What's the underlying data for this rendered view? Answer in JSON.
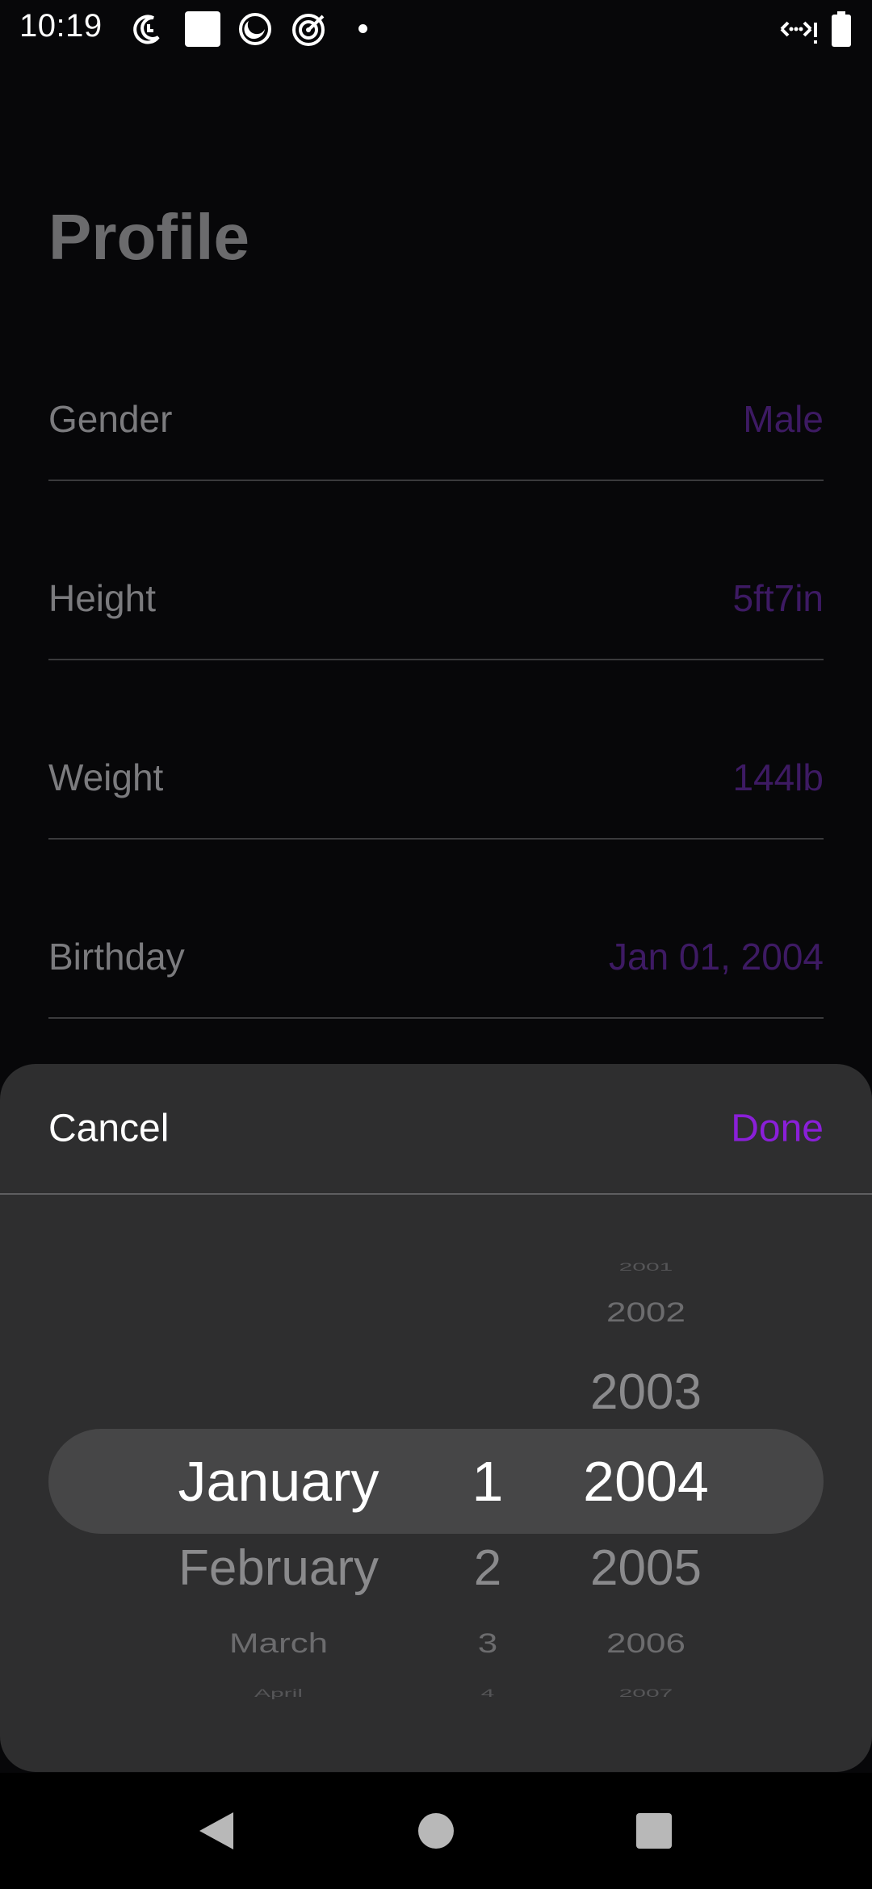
{
  "status_bar": {
    "time": "10:19",
    "icons": [
      "do-not-disturb-moon-icon",
      "white-square-icon",
      "circle-face-icon",
      "target-icon",
      "notification-dot-icon",
      "data-arrows-icon",
      "battery-icon"
    ]
  },
  "profile": {
    "title": "Profile",
    "rows": [
      {
        "label": "Gender",
        "value": "Male"
      },
      {
        "label": "Height",
        "value": "5ft7in"
      },
      {
        "label": "Weight",
        "value": "144lb"
      },
      {
        "label": "Birthday",
        "value": "Jan 01, 2004"
      }
    ]
  },
  "sheet": {
    "cancel_label": "Cancel",
    "done_label": "Done",
    "picker": {
      "months": [
        "January",
        "February",
        "March",
        "April"
      ],
      "days": [
        "1",
        "2",
        "3",
        "4"
      ],
      "years": [
        "2001",
        "2002",
        "2003",
        "2004",
        "2005",
        "2006",
        "2007"
      ],
      "selected": {
        "month": "January",
        "day": "1",
        "year": "2004"
      }
    }
  },
  "colors": {
    "accent": "#8a1fd8",
    "background": "#070709",
    "sheet": "#2e2e2f"
  }
}
